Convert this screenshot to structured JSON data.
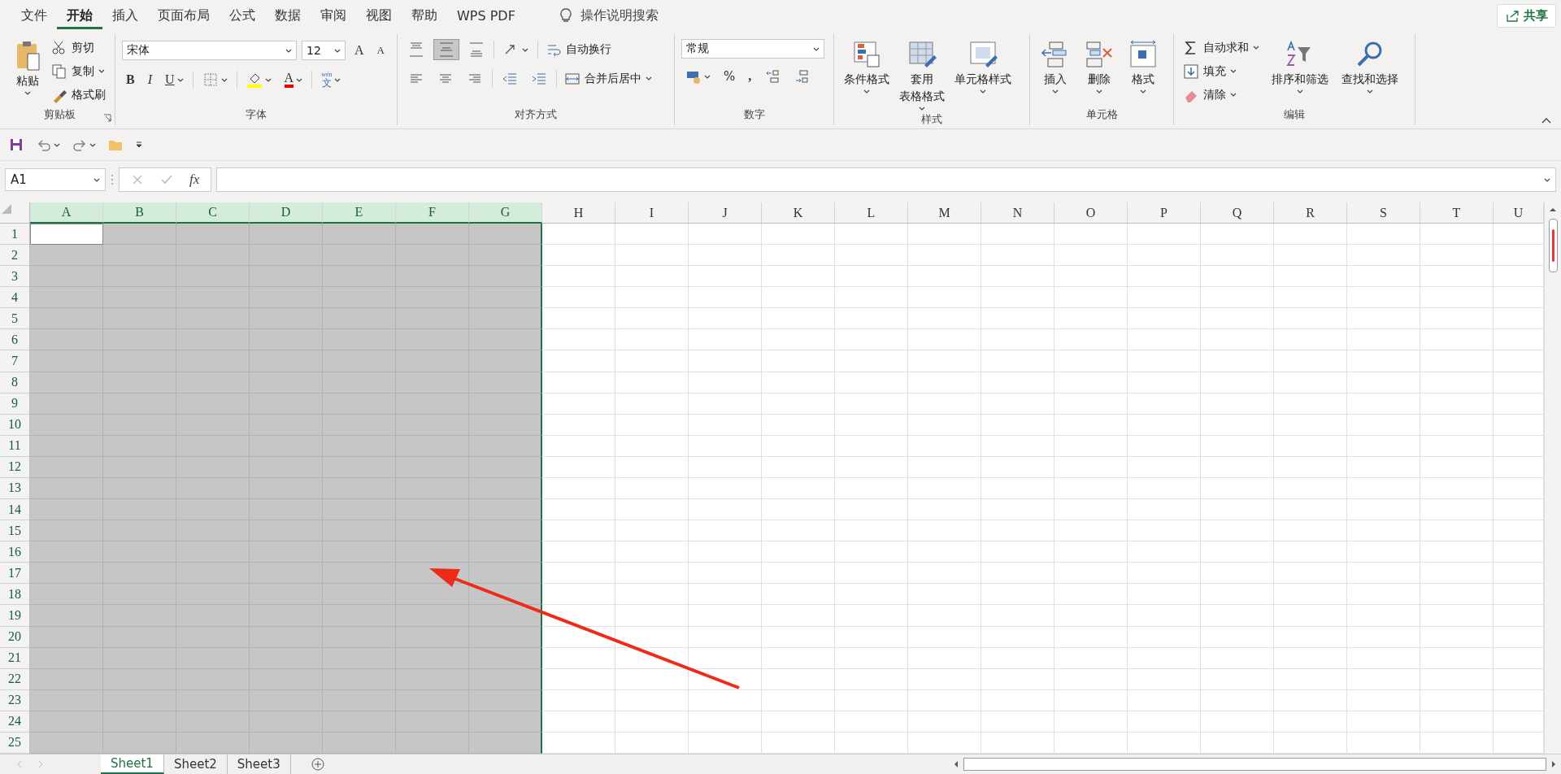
{
  "menu_tabs": [
    {
      "label": "文件",
      "selected": false
    },
    {
      "label": "开始",
      "selected": true
    },
    {
      "label": "插入",
      "selected": false
    },
    {
      "label": "页面布局",
      "selected": false
    },
    {
      "label": "公式",
      "selected": false
    },
    {
      "label": "数据",
      "selected": false
    },
    {
      "label": "审阅",
      "selected": false
    },
    {
      "label": "视图",
      "selected": false
    },
    {
      "label": "帮助",
      "selected": false
    },
    {
      "label": "WPS PDF",
      "selected": false
    }
  ],
  "tell_me": "操作说明搜索",
  "share_button": "共享",
  "clipboard": {
    "label": "剪贴板",
    "paste": "粘贴",
    "items": [
      "剪切",
      "复制",
      "格式刷"
    ]
  },
  "font": {
    "label": "字体",
    "font_name": "宋体",
    "font_size": "12",
    "grow": "A",
    "shrink": "A",
    "bold": "B",
    "italic": "I",
    "underline": "U",
    "font_color": "A",
    "phonetic_top": "wén",
    "phonetic": "文"
  },
  "alignment": {
    "label": "对齐方式",
    "vertical": [
      {
        "selected": false
      },
      {
        "selected": true
      },
      {
        "selected": false
      }
    ],
    "wrap_text": "自动换行",
    "merge_center": "合并后居中"
  },
  "number": {
    "label": "数字",
    "format": "常规",
    "percent": "%",
    "comma": ","
  },
  "styles": {
    "label": "样式",
    "buttons": [
      {
        "lines": [
          "条件格式"
        ]
      },
      {
        "lines": [
          "套用",
          "表格格式"
        ]
      },
      {
        "lines": [
          "单元格样式"
        ]
      }
    ]
  },
  "cells": {
    "label": "单元格",
    "buttons": [
      "插入",
      "删除",
      "格式"
    ]
  },
  "editing": {
    "label": "编辑",
    "small": [
      "自动求和",
      "填充",
      "清除"
    ],
    "large": [
      "排序和筛选",
      "查找和选择"
    ]
  },
  "formula_bar": {
    "name_box": "A1",
    "fx": "fx"
  },
  "sheet": {
    "columns": [
      {
        "label": "A",
        "selected": true
      },
      {
        "label": "B",
        "selected": true
      },
      {
        "label": "C",
        "selected": true
      },
      {
        "label": "D",
        "selected": true
      },
      {
        "label": "E",
        "selected": true
      },
      {
        "label": "F",
        "selected": true
      },
      {
        "label": "G",
        "selected": true
      },
      {
        "label": "H",
        "selected": false
      },
      {
        "label": "I",
        "selected": false
      },
      {
        "label": "J",
        "selected": false
      },
      {
        "label": "K",
        "selected": false
      },
      {
        "label": "L",
        "selected": false
      },
      {
        "label": "M",
        "selected": false
      },
      {
        "label": "N",
        "selected": false
      },
      {
        "label": "O",
        "selected": false
      },
      {
        "label": "P",
        "selected": false
      },
      {
        "label": "Q",
        "selected": false
      },
      {
        "label": "R",
        "selected": false
      },
      {
        "label": "S",
        "selected": false
      },
      {
        "label": "T",
        "selected": false
      },
      {
        "label": "U",
        "selected": false
      }
    ],
    "rows": [
      "1",
      "2",
      "3",
      "4",
      "5",
      "6",
      "7",
      "8",
      "9",
      "10",
      "11",
      "12",
      "13",
      "14",
      "15",
      "16",
      "17",
      "18",
      "19",
      "20",
      "21",
      "22",
      "23",
      "24",
      "25"
    ]
  },
  "sheet_tabs": [
    {
      "label": "Sheet1",
      "selected": true
    },
    {
      "label": "Sheet2",
      "selected": false
    },
    {
      "label": "Sheet3",
      "selected": false
    }
  ]
}
